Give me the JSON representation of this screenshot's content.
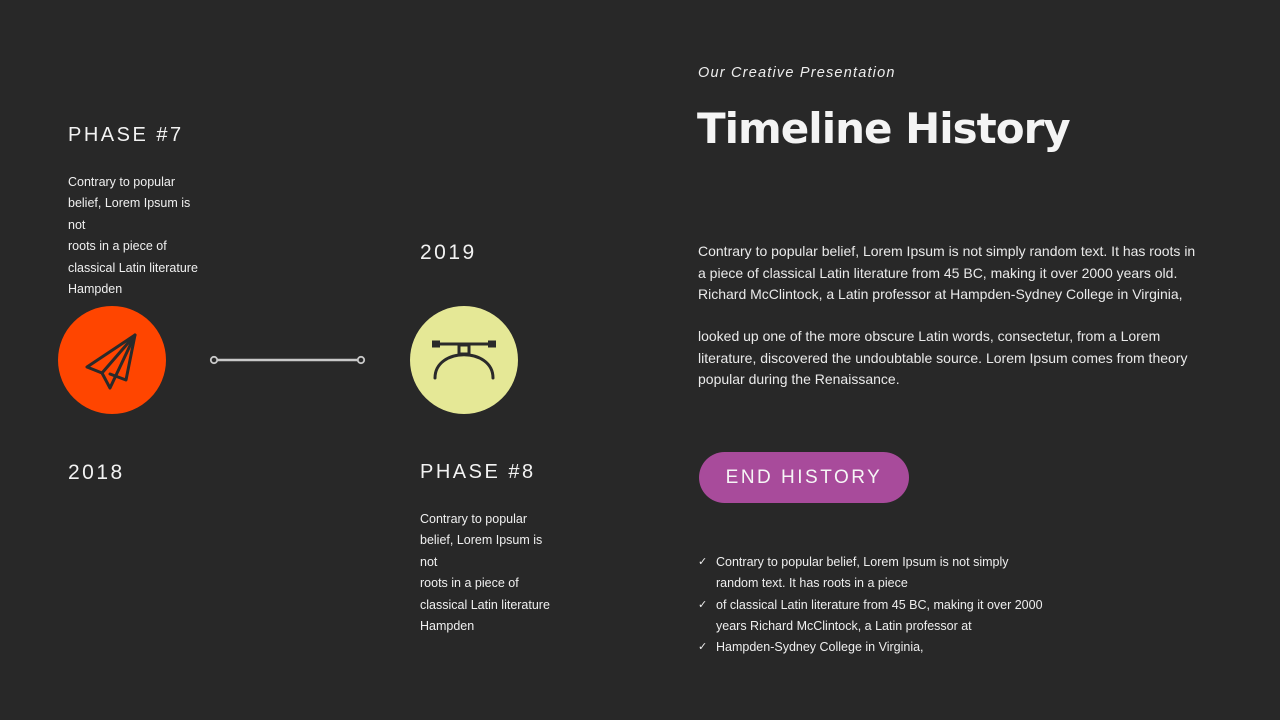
{
  "colors": {
    "background": "#282828",
    "phase7_circle": "#ff4500",
    "phase8_circle": "#e5e896",
    "button": "#a84b9b",
    "connector": "#c8c8c8"
  },
  "phase7": {
    "title": "PHASE #7",
    "body_lines": [
      "Contrary to popular",
      "belief, Lorem Ipsum is",
      "not",
      "roots in a piece of",
      "classical Latin literature",
      "Hampden"
    ],
    "year": "2018",
    "icon": "paper-plane-icon"
  },
  "phase8": {
    "title": "PHASE #8",
    "body_lines": [
      "Contrary to popular",
      "belief, Lorem Ipsum is",
      "not",
      "roots in a piece of",
      "classical Latin literature",
      "Hampden"
    ],
    "year": "2019",
    "icon": "vector-pen-tool-icon"
  },
  "header": {
    "subtitle": "Our Creative Presentation",
    "title": "Timeline History"
  },
  "content": {
    "paragraph1_lines": [
      "Contrary to popular belief, Lorem Ipsum is not simply random text. It has roots in",
      "a piece of classical Latin literature from 45 BC, making it over 2000 years old.",
      "Richard McClintock, a Latin professor at Hampden-Sydney College in Virginia,"
    ],
    "paragraph2_lines": [
      "looked up one of the more obscure Latin words, consectetur, from a Lorem",
      "literature, discovered the undoubtable source. Lorem Ipsum comes from theory",
      "popular during the Renaissance."
    ],
    "button_label": "END HISTORY",
    "checklist": [
      {
        "checked": true,
        "lines": [
          "Contrary to popular belief, Lorem Ipsum is not simply",
          "random text. It has roots in a piece"
        ]
      },
      {
        "checked": true,
        "lines": [
          "of classical Latin literature from 45 BC, making it over 2000",
          "years Richard McClintock, a Latin professor at"
        ]
      },
      {
        "checked": true,
        "lines": [
          "Hampden-Sydney College in Virginia,"
        ]
      }
    ],
    "check_symbol": "✓"
  }
}
